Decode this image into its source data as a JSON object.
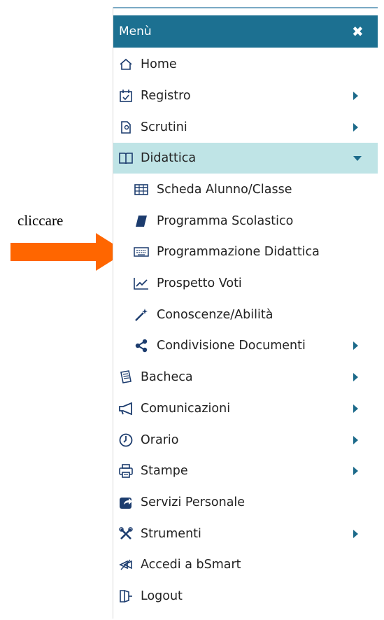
{
  "annotation": {
    "text": "cliccare",
    "arrow_color": "#ff6600"
  },
  "menu": {
    "title": "Menù",
    "close_icon": "close-icon",
    "header_color": "#1c7091",
    "active_color": "#bfe4e6",
    "items": [
      {
        "label": "Home",
        "icon": "home-icon",
        "has_submenu": false
      },
      {
        "label": "Registro",
        "icon": "calendar-check-icon",
        "has_submenu": true
      },
      {
        "label": "Scrutini",
        "icon": "scrutini-icon",
        "has_submenu": true
      },
      {
        "label": "Didattica",
        "icon": "book-open-icon",
        "has_submenu": true,
        "expanded": true
      },
      {
        "label": "Scheda Alunno/Classe",
        "icon": "table-icon",
        "level": 2
      },
      {
        "label": "Programma Scolastico",
        "icon": "book-icon",
        "level": 2
      },
      {
        "label": "Programmazione Didattica",
        "icon": "keyboard-icon",
        "level": 2
      },
      {
        "label": "Prospetto Voti",
        "icon": "line-chart-icon",
        "level": 2
      },
      {
        "label": "Conoscenze/Abilità",
        "icon": "magic-wand-icon",
        "level": 2
      },
      {
        "label": "Condivisione Documenti",
        "icon": "share-icon",
        "level": 2,
        "has_submenu": true
      },
      {
        "label": "Bacheca",
        "icon": "newspaper-icon",
        "has_submenu": true
      },
      {
        "label": "Comunicazioni",
        "icon": "megaphone-icon",
        "has_submenu": true
      },
      {
        "label": "Orario",
        "icon": "clock-icon",
        "has_submenu": true
      },
      {
        "label": "Stampe",
        "icon": "print-icon",
        "has_submenu": true
      },
      {
        "label": "Servizi Personale",
        "icon": "share-square-icon",
        "has_submenu": false
      },
      {
        "label": "Strumenti",
        "icon": "tools-icon",
        "has_submenu": true
      },
      {
        "label": "Accedi a bSmart",
        "icon": "bsmart-icon",
        "has_submenu": false
      },
      {
        "label": "Logout",
        "icon": "logout-icon",
        "has_submenu": false
      }
    ]
  }
}
